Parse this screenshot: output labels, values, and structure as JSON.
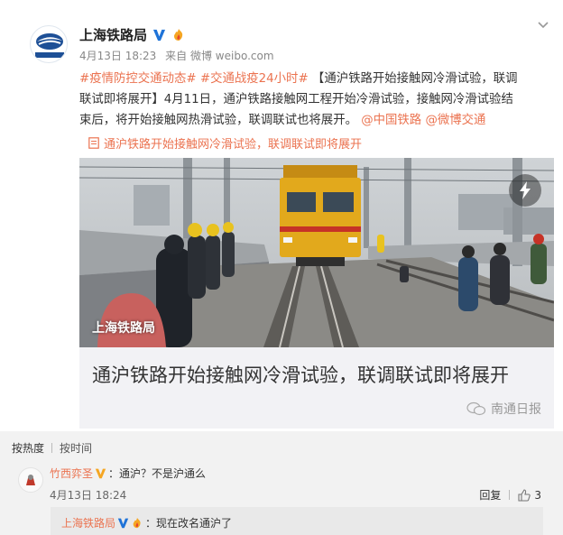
{
  "post": {
    "account_name": "上海铁路局",
    "time": "4月13日 18:23",
    "from_label": "来自",
    "source": "微博 weibo.com",
    "tag1": "#疫情防控交通动态#",
    "tag2": "#交通战疫24小时#",
    "text_line1_rest": " 【通沪铁路开始接触网冷滑试验，联调",
    "text_line2": "联试即将展开】4月11日，通沪铁路接触网工程开始冷滑试验，接触网冷滑试验结",
    "text_line3_a": "束后，将开始接触网热滑试验，联调联试也将展开。",
    "mention1": "@中国铁路",
    "mention2": "@微博交通",
    "article_link": "通沪铁路开始接触网冷滑试验，联调联试即将展开",
    "icons": {
      "verified": "verified-v-icon",
      "fan": "fan-flame-icon",
      "menu": "chevron-down-icon",
      "link": "article-link-icon"
    }
  },
  "card": {
    "watermark": "上海铁路局",
    "title": "通沪铁路开始接触网冷滑试验，联调联试即将展开",
    "source": "南通日报"
  },
  "comments": {
    "sort_hot": "按热度",
    "sort_time": "按时间",
    "items": [
      {
        "user": "竹西弈圣",
        "text": "：通沪？不是沪通么",
        "time": "4月13日 18:24",
        "reply_label": "回复",
        "likes": "3",
        "reply": {
          "user": "上海铁路局",
          "text": "：现在改名通沪了"
        }
      }
    ]
  },
  "colors": {
    "link": "#eb7350",
    "verified": "#1f73d8",
    "comment_bg": "#f2f2f2"
  }
}
